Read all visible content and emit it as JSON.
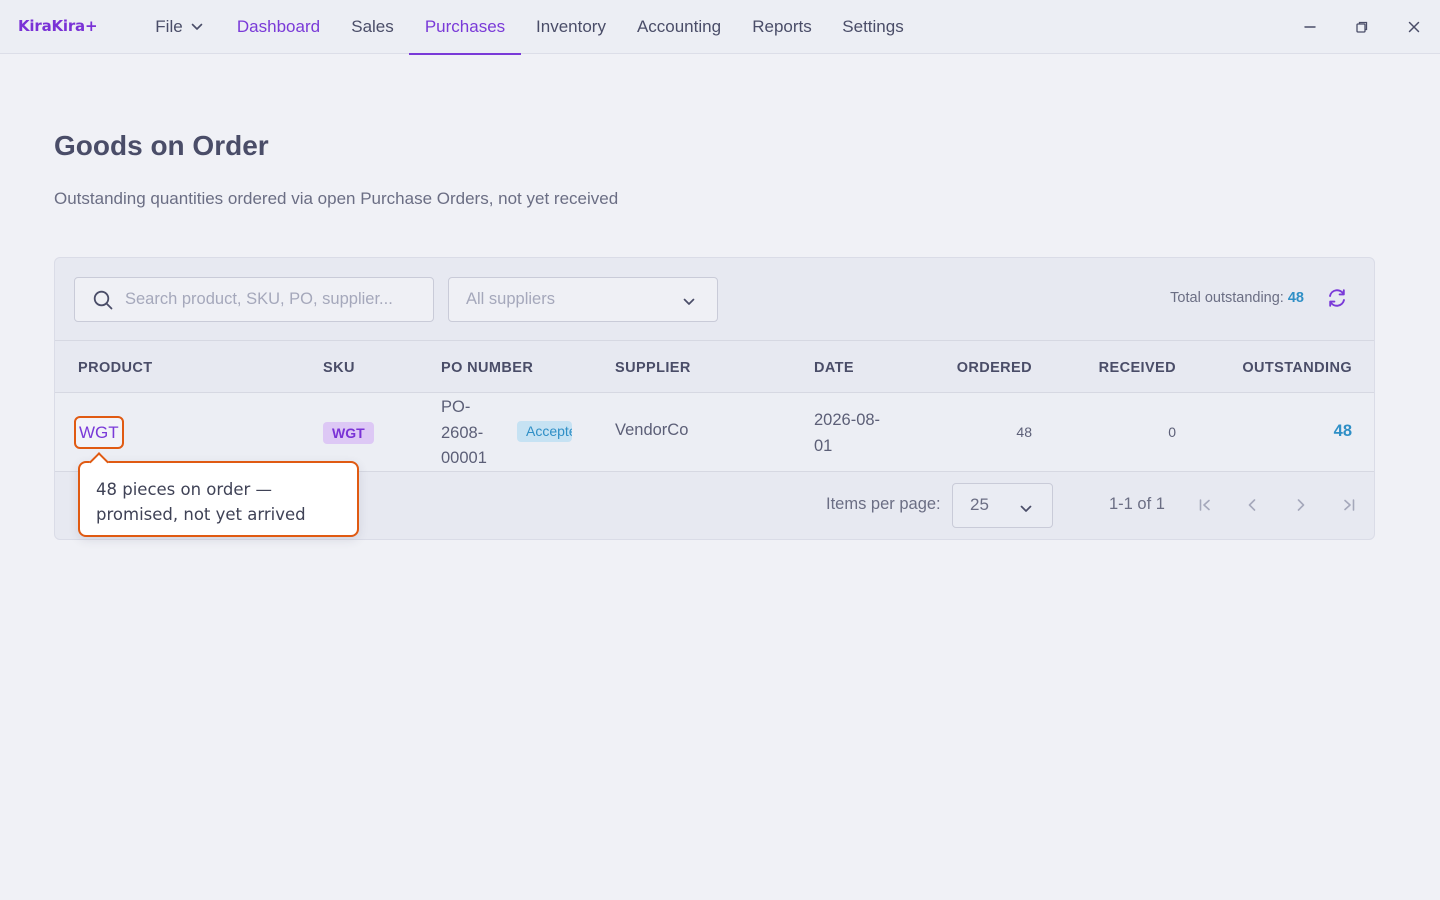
{
  "app": {
    "logo": "KiraKira+"
  },
  "nav": {
    "file": "File",
    "items": [
      {
        "label": "Dashboard"
      },
      {
        "label": "Sales"
      },
      {
        "label": "Purchases"
      },
      {
        "label": "Inventory"
      },
      {
        "label": "Accounting"
      },
      {
        "label": "Reports"
      },
      {
        "label": "Settings"
      }
    ],
    "active": "Purchases"
  },
  "window_controls": [
    "minimize-icon",
    "restore-icon",
    "close-icon"
  ],
  "page": {
    "title": "Goods on Order",
    "subtitle": "Outstanding quantities ordered via open Purchase Orders, not yet received"
  },
  "toolbar": {
    "search_placeholder": "Search product, SKU, PO, supplier...",
    "supplier_filter": "All suppliers",
    "total_label": "Total outstanding: ",
    "total_value": "48"
  },
  "table": {
    "headers": {
      "product": "PRODUCT",
      "sku": "SKU",
      "po_number": "PO NUMBER",
      "supplier": "SUPPLIER",
      "date": "DATE",
      "ordered": "ORDERED",
      "received": "RECEIVED",
      "outstanding": "OUTSTANDING"
    },
    "rows": [
      {
        "product": "WGT",
        "sku": "WGT",
        "po_line1": "PO-",
        "po_line2": "2608-",
        "po_line3": "00001",
        "status": "Accepted",
        "supplier": "VendorCo",
        "date_line1": "2026-08-",
        "date_line2": "01",
        "ordered": "48",
        "received": "0",
        "outstanding": "48"
      }
    ]
  },
  "pagination": {
    "items_per_page_label": "Items per page:",
    "items_per_page": "25",
    "range": "1-1 of 1"
  },
  "tooltip": {
    "line1": "48 pieces on order —",
    "line2": "promised, not yet arrived"
  },
  "colors": {
    "accent": "#7a3ad8",
    "highlight": "#e05a12",
    "outstanding": "#2f8fc6"
  }
}
